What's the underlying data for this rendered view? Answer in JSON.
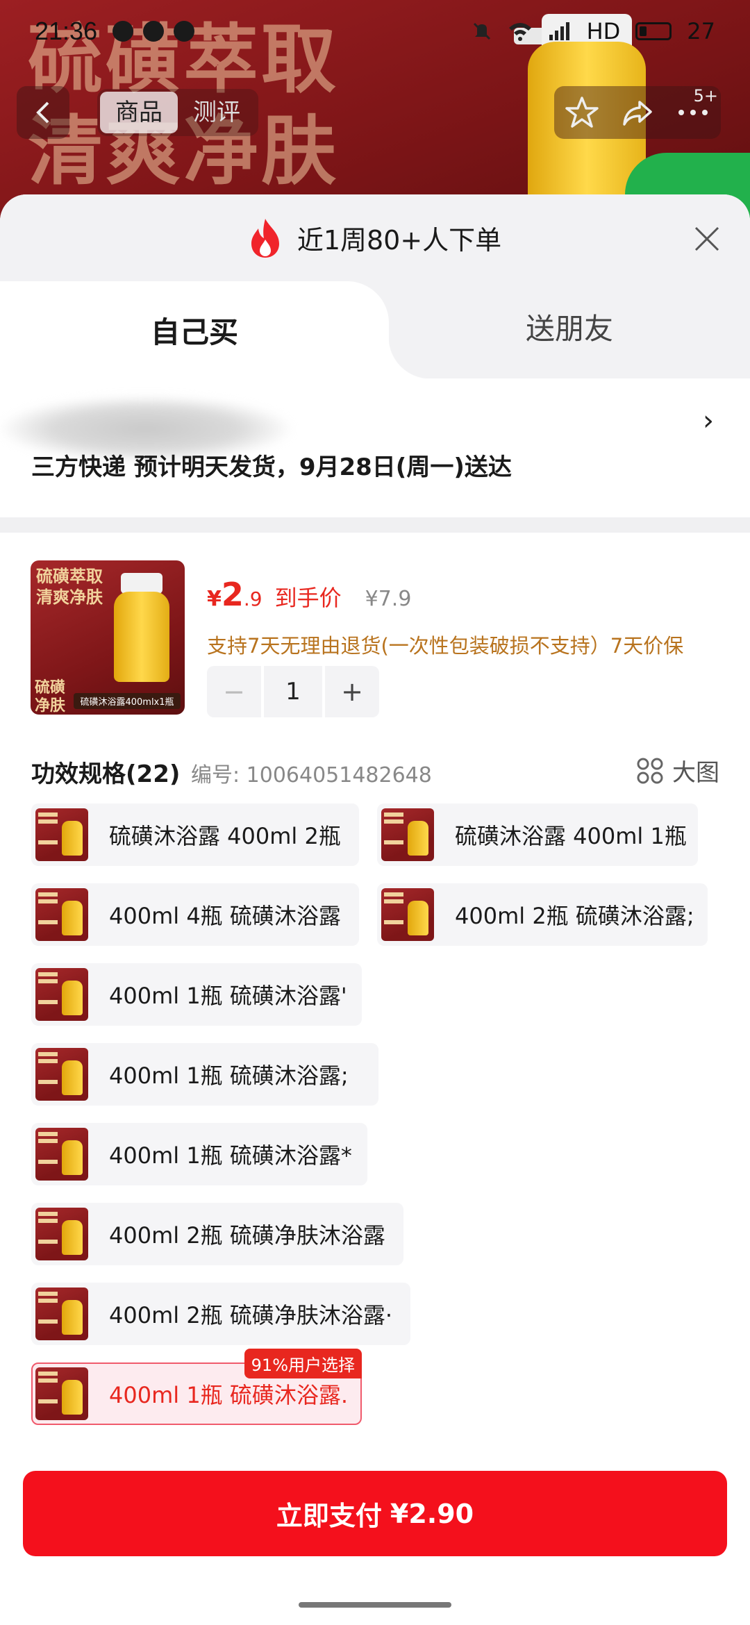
{
  "status_bar": {
    "time": "21:36",
    "network": "HD",
    "battery": "27"
  },
  "nav": {
    "back_icon": "back-arrow-icon",
    "tabs": [
      {
        "label": "商品",
        "active": true
      },
      {
        "label": "测评",
        "active": false
      }
    ],
    "actions": [
      "star-icon",
      "share-icon",
      "more-icon"
    ],
    "badge": "5+"
  },
  "background": {
    "slogan_line1": "硫磺萃取",
    "slogan_line2": "清爽净肤"
  },
  "sheet": {
    "header_text": "近1周80+人下单",
    "close_icon": "close-icon",
    "tabs": {
      "self": "自己买",
      "gift": "送朋友"
    },
    "delivery": "三方快递 预计明天发货，9月28日(周一)送达"
  },
  "product": {
    "thumb_text1": "硫磺萃取\n清爽净肤",
    "thumb_text2": "硫磺\n净肤",
    "thumb_caption": "硫磺沐浴露400mlx1瓶",
    "price_symbol": "¥",
    "price_int": "2",
    "price_dec": ".9",
    "price_label": "到手价",
    "original_price": "¥7.9",
    "service": "支持7天无理由退货(一次性包装破损不支持）7天价保",
    "quantity": "1",
    "minus": "−",
    "plus": "+"
  },
  "spec": {
    "title": "功效规格(22)",
    "code": "编号: 10064051482648",
    "bigview_label": "大图",
    "options": [
      [
        "硫磺沐浴露 400ml 2瓶",
        "硫磺沐浴露 400ml 1瓶"
      ],
      [
        "400ml 4瓶 硫磺沐浴露",
        "400ml 2瓶 硫磺沐浴露;"
      ],
      [
        "400ml 1瓶 硫磺沐浴露'"
      ],
      [
        "400ml 1瓶 硫磺沐浴露;"
      ],
      [
        "400ml 1瓶 硫磺沐浴露*"
      ],
      [
        "400ml 2瓶 硫磺净肤沐浴露"
      ],
      [
        "400ml 2瓶 硫磺净肤沐浴露·"
      ],
      [
        "400ml 1瓶 硫磺沐浴露."
      ]
    ],
    "selected_badge": "91%用户选择"
  },
  "footer": {
    "pay_label": "立即支付",
    "pay_price": "¥2.90"
  },
  "colors": {
    "accent": "#f4101c",
    "price": "#e8271f",
    "service": "#b8731e",
    "selected_bg": "#fdebef"
  }
}
